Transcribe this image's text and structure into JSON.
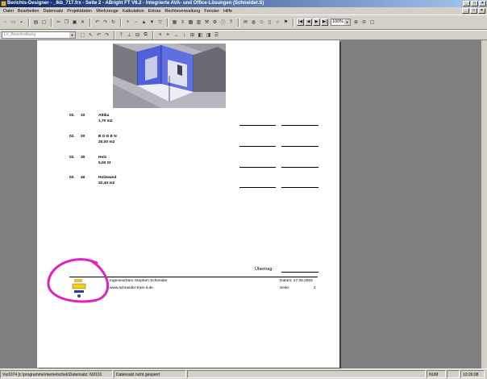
{
  "window": {
    "title": "Berichts-Designer - _lkb_717.frx - Seite 2 - ABright FT V6.2 - Integrierte AVA- und Office-Lösungen (Schneider.S)"
  },
  "menu": [
    "Datei",
    "Bearbeiten",
    "Datensatz",
    "Projektdaten",
    "Werkzeuge",
    "Kalkulation",
    "Extras",
    "Rechteverwaltung",
    "Fenster",
    "Hilfe"
  ],
  "toolbar": {
    "zoom": "100%",
    "field_placeholder": "LV_Beschreibung"
  },
  "report": {
    "positions": [
      {
        "nr1": "02.",
        "nr2": "10",
        "name": "Attika",
        "qty": "1,70 m2"
      },
      {
        "nr1": "02.",
        "nr2": "20",
        "name": "B O D E N",
        "qty": "20,00 m2"
      },
      {
        "nr1": "02.",
        "nr2": "30",
        "name": "Holz",
        "qty": "5,00 St"
      },
      {
        "nr1": "02.",
        "nr2": "40",
        "name": "Holzwand",
        "qty": "32,40 m2"
      }
    ],
    "uebertrag_label": "Übertrag:",
    "footer": {
      "company": "Ingenieurbüro Stephen Schneider",
      "website": "www.schneider-train-it.de",
      "date_label": "Datum:  27.05.2002",
      "page_label": "Seite:",
      "page_value": "2"
    }
  },
  "statusbar": {
    "path": "Vw1074 [c:\\programme\\memetschek\\Datensatz: 60/101",
    "message": "Datensatz nicht gesperrt",
    "num": "NUM",
    "time": "10:26:08"
  },
  "colors": {
    "titlebar": "#0a246a",
    "highlight": "#e020c0",
    "model_blue": "#5060d8"
  }
}
